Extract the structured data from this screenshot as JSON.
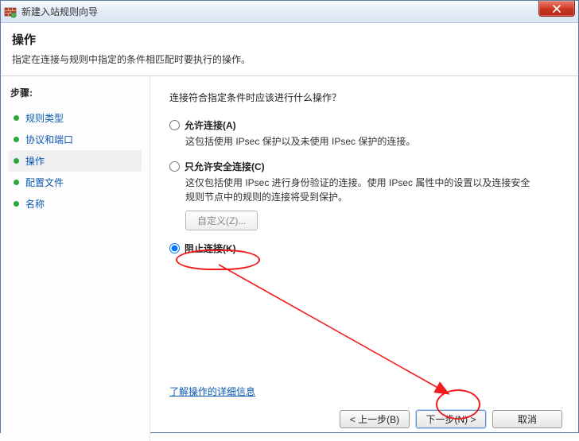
{
  "title": "新建入站规则向导",
  "header": {
    "heading": "操作",
    "subtitle": "指定在连接与规则中指定的条件相匹配时要执行的操作。"
  },
  "sidebar": {
    "steps_label": "步骤:",
    "items": [
      {
        "label": "规则类型",
        "current": false
      },
      {
        "label": "协议和端口",
        "current": false
      },
      {
        "label": "操作",
        "current": true
      },
      {
        "label": "配置文件",
        "current": false
      },
      {
        "label": "名称",
        "current": false
      }
    ]
  },
  "main": {
    "question": "连接符合指定条件时应该进行什么操作？",
    "options": [
      {
        "id": "allow",
        "label": "允许连接(A)",
        "desc": "这包括使用 IPsec 保护以及未使用 IPsec 保护的连接。",
        "selected": false
      },
      {
        "id": "allow-secure",
        "label": "只允许安全连接(C)",
        "desc": "这仅包括使用 IPsec 进行身份验证的连接。使用 IPsec 属性中的设置以及连接安全规则节点中的规则的连接将受到保护。",
        "selected": false,
        "custom_btn": "自定义(Z)..."
      },
      {
        "id": "block",
        "label": "阻止连接(K)",
        "desc": "",
        "selected": true
      }
    ],
    "learn_more": "了解操作的详细信息"
  },
  "buttons": {
    "back": "< 上一步(B)",
    "next": "下一步(N) >",
    "cancel": "取消"
  }
}
